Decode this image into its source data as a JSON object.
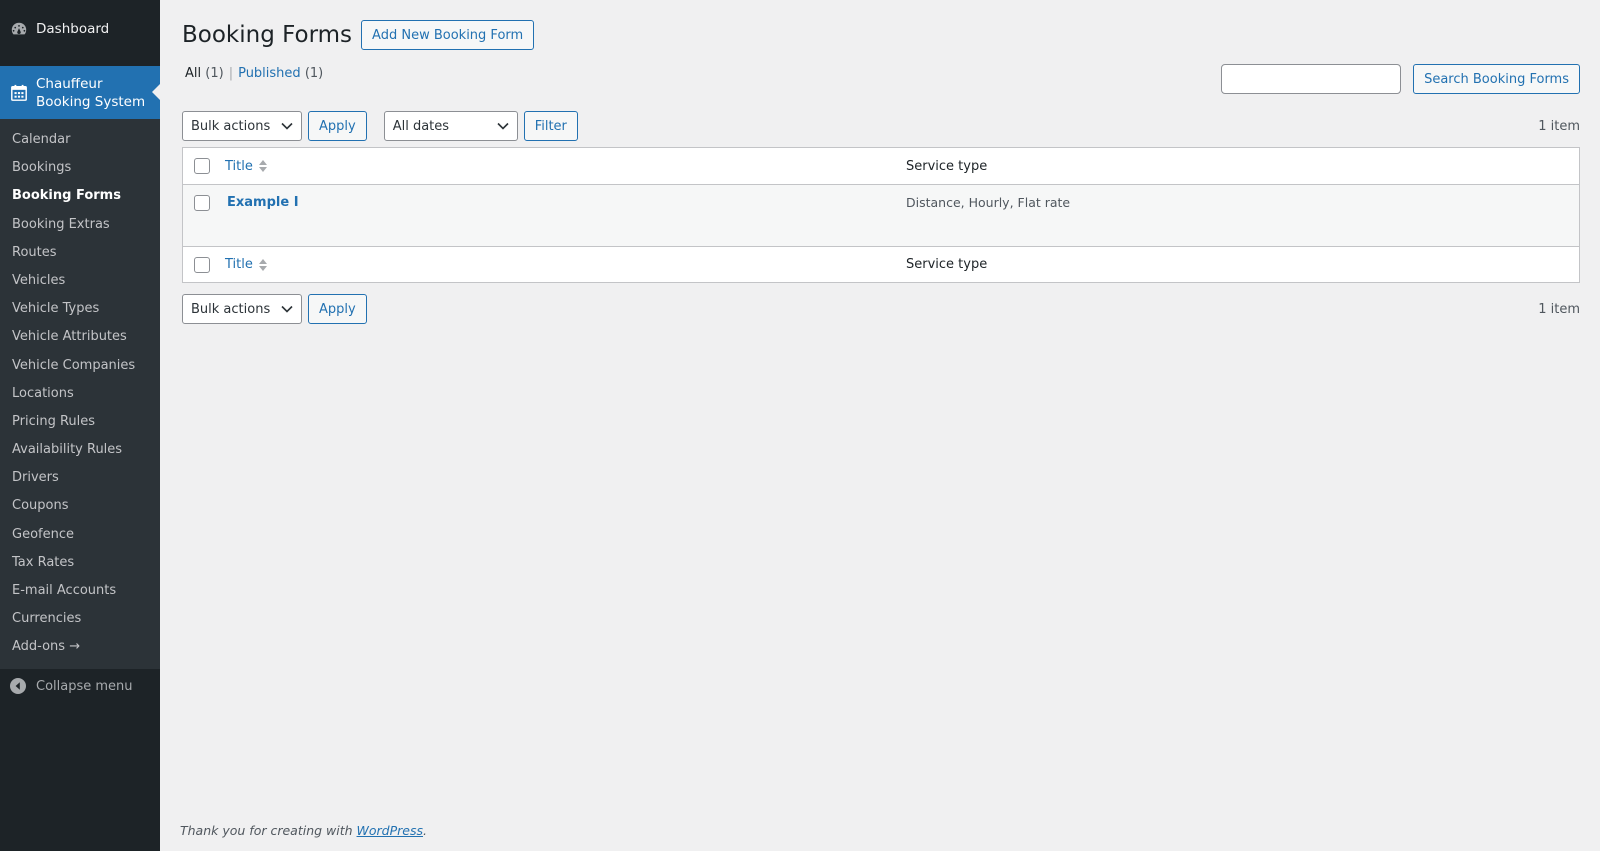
{
  "sidebar": {
    "dashboard_label": "Dashboard",
    "plugin_label": "Chauffeur Booking System",
    "items": [
      {
        "label": "Calendar"
      },
      {
        "label": "Bookings"
      },
      {
        "label": "Booking Forms",
        "current": true
      },
      {
        "label": "Booking Extras"
      },
      {
        "label": "Routes"
      },
      {
        "label": "Vehicles"
      },
      {
        "label": "Vehicle Types"
      },
      {
        "label": "Vehicle Attributes"
      },
      {
        "label": "Vehicle Companies"
      },
      {
        "label": "Locations"
      },
      {
        "label": "Pricing Rules"
      },
      {
        "label": "Availability Rules"
      },
      {
        "label": "Drivers"
      },
      {
        "label": "Coupons"
      },
      {
        "label": "Geofence"
      },
      {
        "label": "Tax Rates"
      },
      {
        "label": "E-mail Accounts"
      },
      {
        "label": "Currencies"
      },
      {
        "label": "Add-ons →"
      }
    ],
    "collapse_label": "Collapse menu"
  },
  "header": {
    "title": "Booking Forms",
    "add_new_label": "Add New Booking Form"
  },
  "views": {
    "all_label": "All",
    "all_count": "(1)",
    "separator": "|",
    "published_label": "Published",
    "published_count": "(1)"
  },
  "search": {
    "value": "",
    "button_label": "Search Booking Forms"
  },
  "tablenav": {
    "bulk_actions": "Bulk actions",
    "apply_label": "Apply",
    "dates_filter": "All dates",
    "filter_label": "Filter",
    "items_count": "1 item"
  },
  "table": {
    "columns": {
      "title": "Title",
      "service_type": "Service type"
    },
    "rows": [
      {
        "title": "Example I",
        "service_type": "Distance, Hourly, Flat rate"
      }
    ]
  },
  "footer": {
    "text": "Thank you for creating with",
    "link": "WordPress",
    "suffix": "."
  },
  "colors": {
    "sidebar_bg": "#1d2327",
    "submenu_bg": "#2c3338",
    "accent": "#2271b1",
    "page_bg": "#f0f0f1"
  }
}
